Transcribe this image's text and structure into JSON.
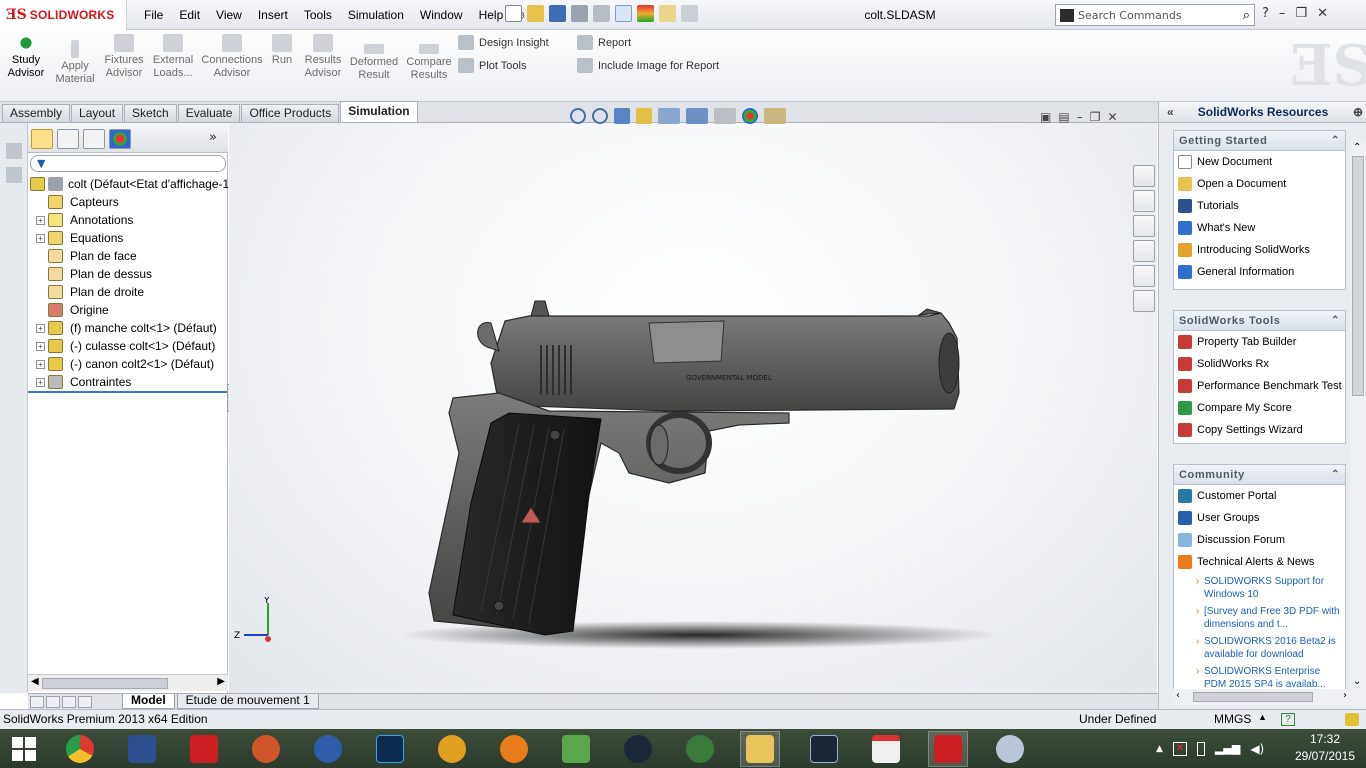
{
  "app": {
    "logo_text": "SOLIDWORKS",
    "document_title": "colt.SLDASM",
    "menus": [
      "File",
      "Edit",
      "View",
      "Insert",
      "Tools",
      "Simulation",
      "Window",
      "Help"
    ],
    "search_placeholder": "Search Commands"
  },
  "commands": {
    "study_advisor": [
      "Study",
      "Advisor"
    ],
    "apply_material": [
      "Apply",
      "Material"
    ],
    "fixtures_advisor": [
      "Fixtures",
      "Advisor"
    ],
    "external_loads": [
      "External",
      "Loads..."
    ],
    "connections_advisor": [
      "Connections",
      "Advisor"
    ],
    "run": [
      "Run"
    ],
    "results_advisor": [
      "Results",
      "Advisor"
    ],
    "deformed_result": [
      "Deformed",
      "Result"
    ],
    "compare_results": [
      "Compare",
      "Results"
    ],
    "design_insight": "Design Insight",
    "plot_tools": "Plot Tools",
    "report": "Report",
    "include_image": "Include Image for Report"
  },
  "tabs": [
    "Assembly",
    "Layout",
    "Sketch",
    "Evaluate",
    "Office Products",
    "Simulation"
  ],
  "active_tab": "Simulation",
  "tree": [
    {
      "label": "colt  (Défaut<Etat d'affichage-1>)",
      "level": 0,
      "expander": "",
      "color": "#e8c84a"
    },
    {
      "label": "Capteurs",
      "level": 1,
      "expander": "",
      "color": "#f2d46a"
    },
    {
      "label": "Annotations",
      "level": 1,
      "expander": "+",
      "color": "#f7e27e"
    },
    {
      "label": "Equations",
      "level": 1,
      "expander": "+",
      "color": "#f2d46a"
    },
    {
      "label": "Plan de face",
      "level": 1,
      "expander": "",
      "color": "#f5d9a0"
    },
    {
      "label": "Plan de dessus",
      "level": 1,
      "expander": "",
      "color": "#f5d9a0"
    },
    {
      "label": "Plan de droite",
      "level": 1,
      "expander": "",
      "color": "#f5d9a0"
    },
    {
      "label": "Origine",
      "level": 1,
      "expander": "",
      "color": "#d77a6b"
    },
    {
      "label": "(f) manche colt<1> (Défaut)",
      "level": 1,
      "expander": "+",
      "color": "#e8c84a"
    },
    {
      "label": "(-) culasse colt<1> (Défaut)",
      "level": 1,
      "expander": "+",
      "color": "#e8c84a"
    },
    {
      "label": "(-) canon colt2<1> (Défaut)",
      "level": 1,
      "expander": "+",
      "color": "#e8c84a"
    },
    {
      "label": "Contraintes",
      "level": 1,
      "expander": "+",
      "color": "#b9b9b9"
    }
  ],
  "model_tabs": [
    "Model",
    "Etude de mouvement 1"
  ],
  "engraving": "GOVERNMENTAL MODEL",
  "task_pane": {
    "title": "SolidWorks Resources",
    "getting_started": {
      "header": "Getting Started",
      "items": [
        "New Document",
        "Open a Document",
        "Tutorials",
        "What's New",
        "Introducing SolidWorks",
        "General Information"
      ]
    },
    "tools": {
      "header": "SolidWorks Tools",
      "items": [
        "Property Tab Builder",
        "SolidWorks Rx",
        "Performance Benchmark Test",
        "Compare My Score",
        "Copy Settings Wizard"
      ]
    },
    "community": {
      "header": "Community",
      "items": [
        "Customer Portal",
        "User Groups",
        "Discussion Forum",
        "Technical Alerts & News"
      ],
      "news": [
        "SOLIDWORKS Support for Windows 10",
        "[Survey and Free 3D PDF with dimensions and t...",
        "SOLIDWORKS 2016 Beta2 is available for download",
        "SOLIDWORKS Enterprise PDM 2015 SP4 is availab..."
      ]
    }
  },
  "status": {
    "edition": "SolidWorks Premium 2013 x64 Edition",
    "state": "Under Defined",
    "units": "MMGS"
  },
  "clock": {
    "time": "17:32",
    "date": "29/07/2015"
  },
  "triad": {
    "y": "Y",
    "z": "Z"
  },
  "colors": {
    "brand": "#d4161b",
    "accent": "#3c78c8",
    "link": "#1d5fb0"
  }
}
